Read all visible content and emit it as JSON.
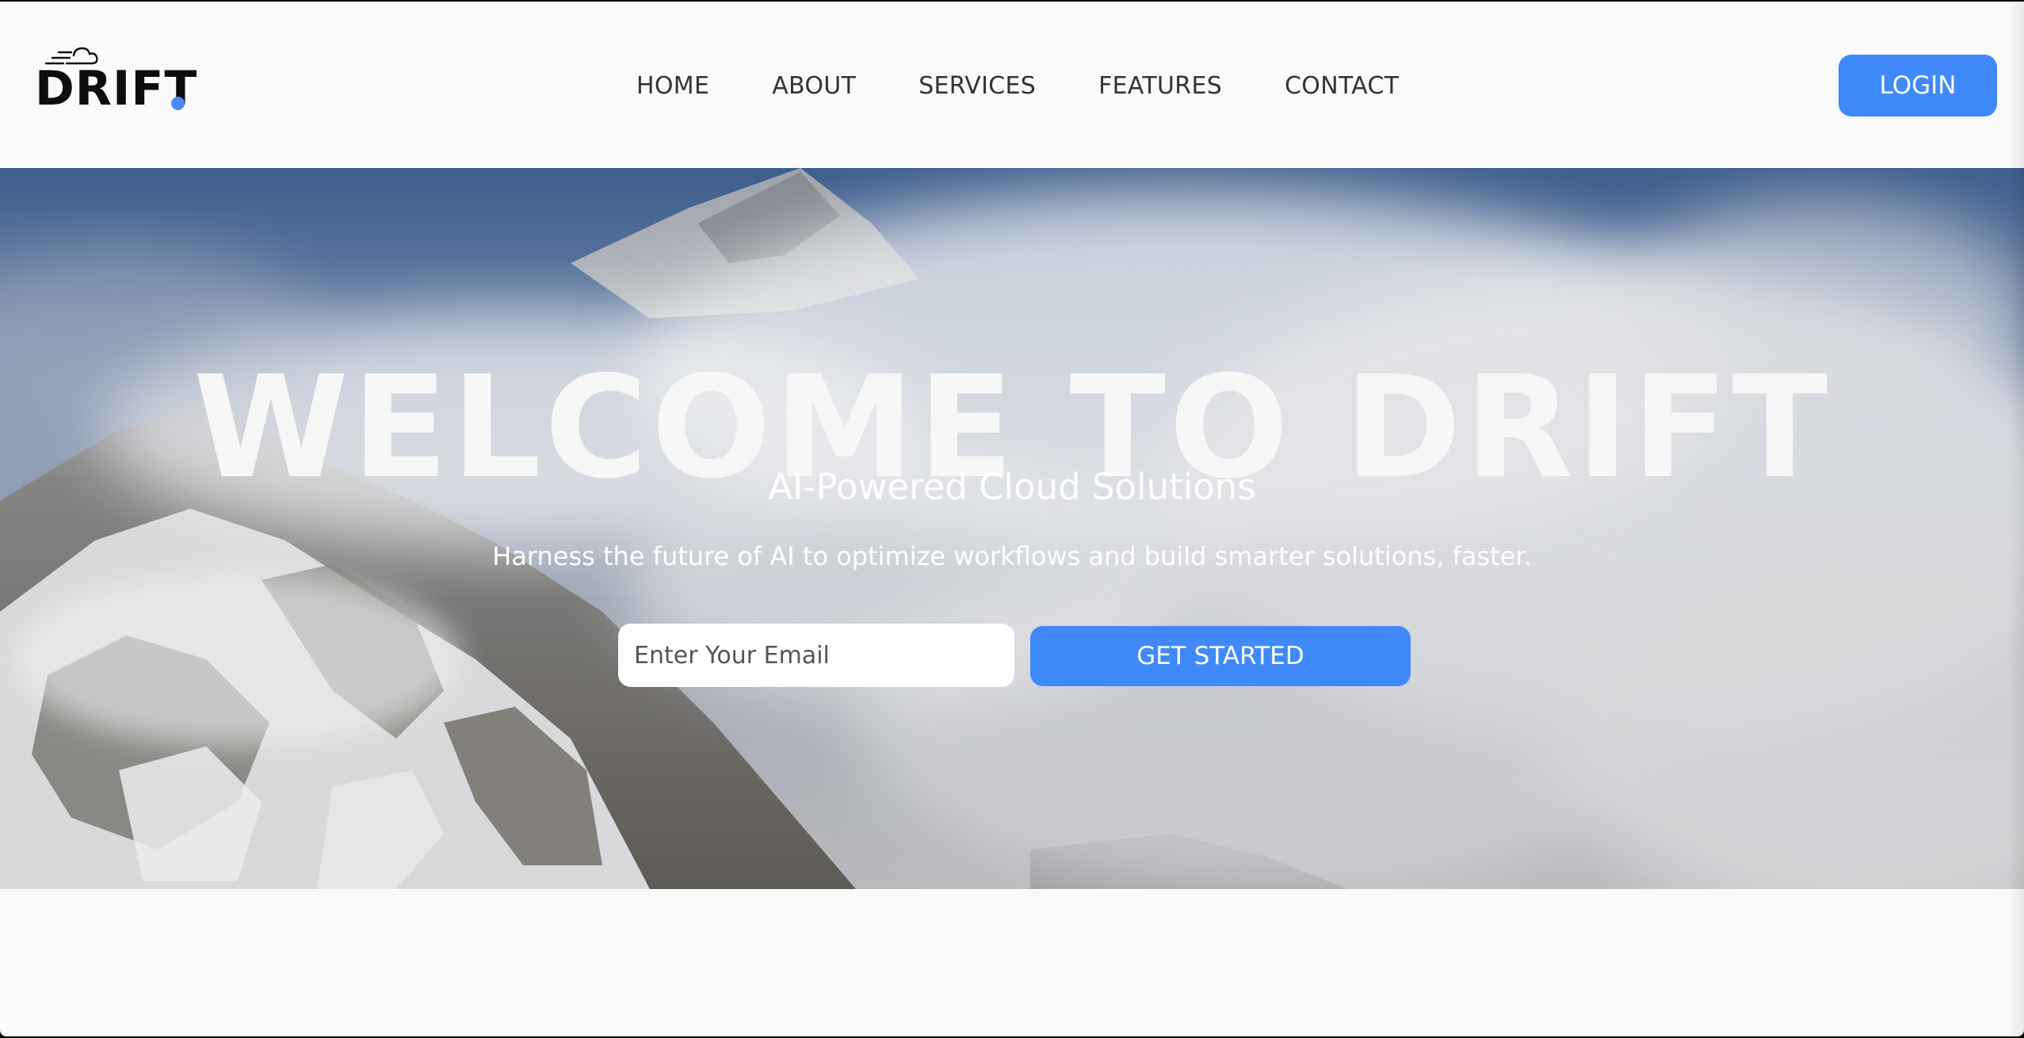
{
  "header": {
    "logo_text": "DRIFT",
    "nav": [
      {
        "label": "HOME"
      },
      {
        "label": "ABOUT"
      },
      {
        "label": "SERVICES"
      },
      {
        "label": "FEATURES"
      },
      {
        "label": "CONTACT"
      }
    ],
    "login_label": "LOGIN"
  },
  "hero": {
    "title": "WELCOME TO DRIFT",
    "subtitle": "AI-Powered Cloud Solutions",
    "description": "Harness the future of AI to optimize workflows and build smarter solutions, faster.",
    "email_placeholder": "Enter Your Email",
    "cta_label": "GET STARTED"
  },
  "colors": {
    "accent": "#4089fb",
    "logo_dot": "#4a8af4",
    "page_background": "#fafafa"
  },
  "icons": {
    "logo": "cloud-icon"
  }
}
